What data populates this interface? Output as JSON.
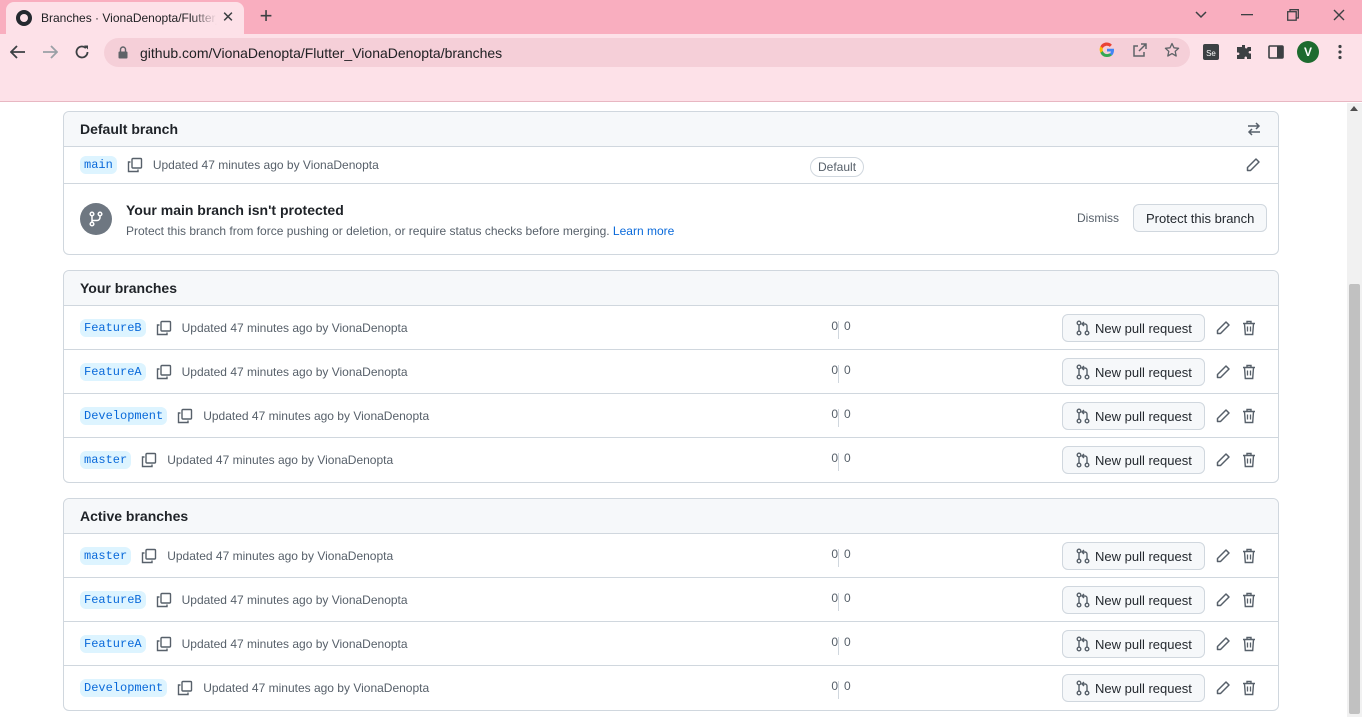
{
  "browser": {
    "tab_title": "Branches · VionaDenopta/Flutter_VionaDenopta",
    "url": "github.com/VionaDenopta/Flutter_VionaDenopta/branches",
    "profile_initial": "V",
    "extension_label": "Se"
  },
  "default_branch": {
    "header": "Default branch",
    "branch": {
      "name": "main",
      "meta": "Updated 47 minutes ago by VionaDenopta",
      "badge": "Default"
    },
    "notice": {
      "title": "Your main branch isn't protected",
      "description": "Protect this branch from force pushing or deletion, or require status checks before merging.",
      "link": "Learn more",
      "dismiss": "Dismiss",
      "protect_button": "Protect this branch"
    }
  },
  "your_branches": {
    "header": "Your branches",
    "rows": [
      {
        "name": "FeatureB",
        "meta": "Updated 47 minutes ago by VionaDenopta",
        "ahead": "0",
        "behind": "0",
        "pr_label": "New pull request"
      },
      {
        "name": "FeatureA",
        "meta": "Updated 47 minutes ago by VionaDenopta",
        "ahead": "0",
        "behind": "0",
        "pr_label": "New pull request"
      },
      {
        "name": "Development",
        "meta": "Updated 47 minutes ago by VionaDenopta",
        "ahead": "0",
        "behind": "0",
        "pr_label": "New pull request"
      },
      {
        "name": "master",
        "meta": "Updated 47 minutes ago by VionaDenopta",
        "ahead": "0",
        "behind": "0",
        "pr_label": "New pull request"
      }
    ]
  },
  "active_branches": {
    "header": "Active branches",
    "rows": [
      {
        "name": "master",
        "meta": "Updated 47 minutes ago by VionaDenopta",
        "ahead": "0",
        "behind": "0",
        "pr_label": "New pull request"
      },
      {
        "name": "FeatureB",
        "meta": "Updated 47 minutes ago by VionaDenopta",
        "ahead": "0",
        "behind": "0",
        "pr_label": "New pull request"
      },
      {
        "name": "FeatureA",
        "meta": "Updated 47 minutes ago by VionaDenopta",
        "ahead": "0",
        "behind": "0",
        "pr_label": "New pull request"
      },
      {
        "name": "Development",
        "meta": "Updated 47 minutes ago by VionaDenopta",
        "ahead": "0",
        "behind": "0",
        "pr_label": "New pull request"
      }
    ]
  },
  "colors": {
    "tabbar": "#f9aebf",
    "toolbar": "#fde1e8",
    "link": "#0969da",
    "branch_tag_bg": "#ddf4ff"
  }
}
